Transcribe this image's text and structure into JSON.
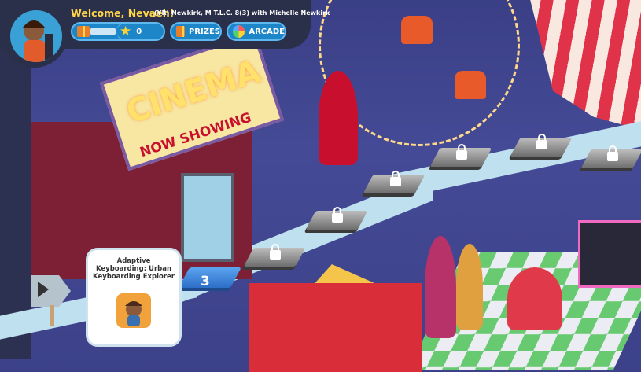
{
  "header": {
    "welcome": "Welcome, Nevaeh!",
    "session": "(YR) Newkirk, M T.L.C. 8(3) with Michelle Newkirk",
    "stars_count": "0",
    "progress_fraction": 0.05,
    "prizes_label": "PRIZES",
    "arcade_label": "ARCADE"
  },
  "map": {
    "current_level": "3",
    "locked_levels": 6
  },
  "activity_card": {
    "title": "Adaptive Keyboarding: Urban Keyboarding Explorer"
  },
  "scene": {
    "cinema_sign": "CINEMA",
    "marquee_text": "NOW SHOWING"
  },
  "colors": {
    "header_bg": "#2a2f4a",
    "welcome_text": "#ffd54a",
    "pill_blue": "#1c86c9",
    "current_tile": "#2d6ec7"
  }
}
